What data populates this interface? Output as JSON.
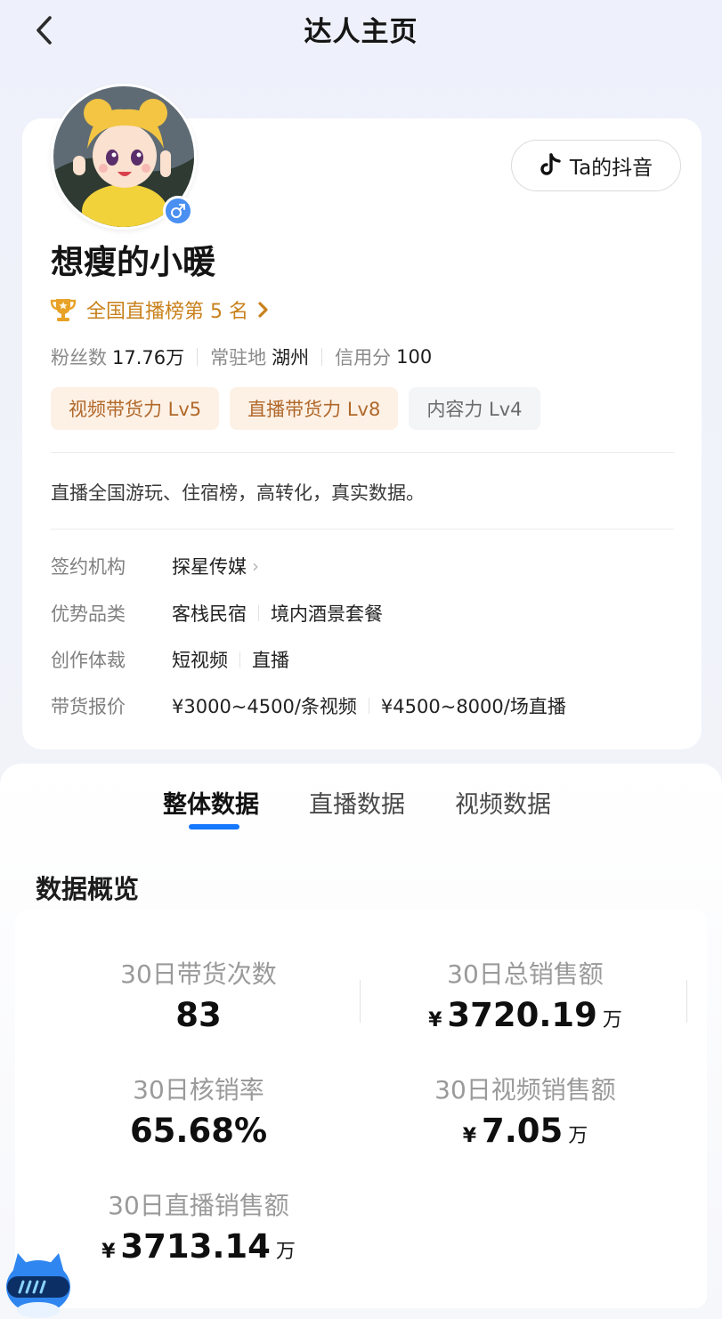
{
  "header": {
    "title": "达人主页"
  },
  "profile": {
    "name": "想瘦的小暖",
    "douyin_btn_label": "Ta的抖音",
    "rank_text": "全国直播榜第 5 名",
    "stats": [
      {
        "key": "粉丝数",
        "value": "17.76万"
      },
      {
        "key": "常驻地",
        "value": "湖州"
      },
      {
        "key": "信用分",
        "value": "100"
      }
    ],
    "tags": [
      "视频带货力 Lv5",
      "直播带货力 Lv8",
      "内容力 Lv4"
    ],
    "bio": "直播全国游玩、住宿榜，高转化，真实数据。",
    "info": {
      "agency_label": "签约机构",
      "agency_value": "探星传媒",
      "category_label": "优势品类",
      "category_values": [
        "客栈民宿",
        "境内酒景套餐"
      ],
      "genre_label": "创作体裁",
      "genre_values": [
        "短视频",
        "直播"
      ],
      "price_label": "带货报价",
      "price_values": [
        "¥3000~4500/条视频",
        "¥4500~8000/场直播"
      ]
    }
  },
  "tabs": [
    "整体数据",
    "直播数据",
    "视频数据"
  ],
  "section_title": "数据概览",
  "metrics": [
    {
      "label": "30日带货次数",
      "value": "83",
      "currency": "",
      "unit": ""
    },
    {
      "label": "30日总销售额",
      "value": "3720.19",
      "currency": "¥",
      "unit": "万"
    },
    {
      "label": "30日核销率",
      "value": "65.68%",
      "currency": "",
      "unit": ""
    },
    {
      "label": "30日视频销售额",
      "value": "7.05",
      "currency": "¥",
      "unit": "万"
    },
    {
      "label": "30日直播销售额",
      "value": "3713.14",
      "currency": "¥",
      "unit": "万"
    }
  ],
  "colors": {
    "accent": "#1677ff",
    "rank": "#c9811c",
    "tag_warm_bg": "#fdf1e6",
    "tag_warm_text": "#b0682a"
  }
}
